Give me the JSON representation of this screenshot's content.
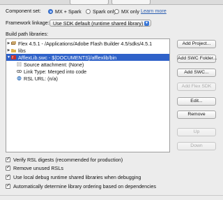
{
  "component_set": {
    "label": "Component set:",
    "options": [
      {
        "label": "MX + Spark",
        "selected": true
      },
      {
        "label": "Spark only",
        "selected": false
      },
      {
        "label": "MX only",
        "selected": false
      }
    ],
    "help_link": "Learn more"
  },
  "framework_linkage": {
    "label": "Framework linkage:",
    "value": "Use SDK default (runtime shared library)"
  },
  "build_path": {
    "label": "Build path libraries:",
    "tree": [
      {
        "label": "Flex 4.5.1 - /Applications/Adobe Flash Builder 4.5/sdks/4.5.1",
        "expanded": false,
        "icon": "library-icon"
      },
      {
        "label": "libs",
        "expanded": false,
        "icon": "folder-icon"
      },
      {
        "label": "AfflexLib.swc - ${DOCUMENTS}/afflexlib/bin",
        "expanded": true,
        "icon": "swc-icon",
        "selected": true
      },
      {
        "label": "Source attachment: (None)",
        "child": true,
        "icon": "source-icon"
      },
      {
        "label": "Link Type: Merged into code",
        "child": true,
        "icon": "link-icon"
      },
      {
        "label": "RSL URL: (n/a)",
        "child": true,
        "icon": "globe-icon"
      }
    ]
  },
  "buttons": [
    {
      "label": "Add Project...",
      "enabled": true
    },
    {
      "label": "Add SWC Folder...",
      "enabled": true
    },
    {
      "label": "Add SWC...",
      "enabled": true
    },
    {
      "label": "Add Flex SDK",
      "enabled": false
    },
    {
      "label": "Edit...",
      "enabled": true
    },
    {
      "label": "Remove",
      "enabled": true
    },
    {
      "label": "Up",
      "enabled": false
    },
    {
      "label": "Down",
      "enabled": false
    }
  ],
  "options": [
    {
      "label": "Verify RSL digests (recommended for production)",
      "checked": true
    },
    {
      "label": "Remove unused RSLs",
      "checked": true
    },
    {
      "label": "Use local debug runtime shared libraries when debugging",
      "checked": true
    },
    {
      "label": "Automatically determine library ordering based on dependencies",
      "checked": true
    }
  ],
  "colors": {
    "selection": "#2f62c9",
    "link": "#2a5db0",
    "window_bg": "#ececec"
  }
}
